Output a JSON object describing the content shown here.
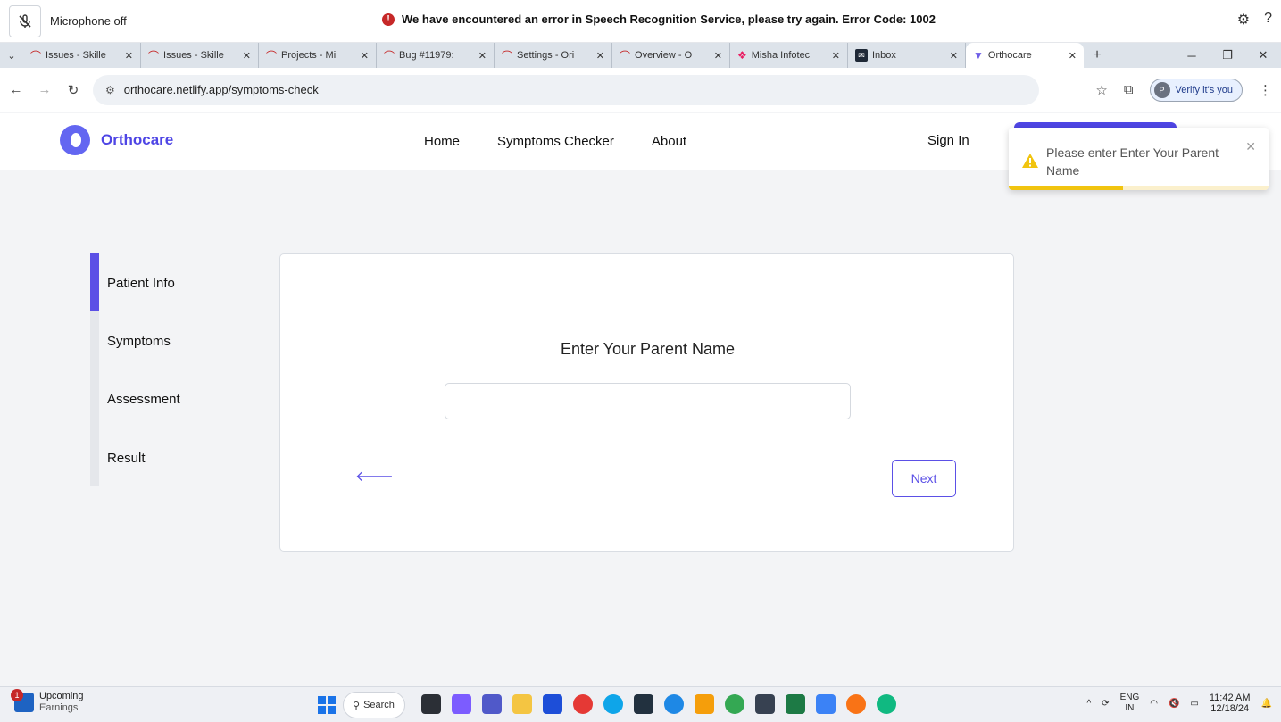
{
  "notification_bar": {
    "mic_status": "Microphone off",
    "error_message": "We have encountered an error in Speech Recognition Service, please try again. Error Code: 1002"
  },
  "tabs": [
    {
      "title": "Issues - Skille",
      "icon": "issue-icon",
      "active": false
    },
    {
      "title": "Issues - Skille",
      "icon": "issue-icon",
      "active": false
    },
    {
      "title": "Projects - Mi",
      "icon": "issue-icon",
      "active": false
    },
    {
      "title": "Bug #11979:",
      "icon": "issue-icon",
      "active": false
    },
    {
      "title": "Settings - Ori",
      "icon": "issue-icon",
      "active": false
    },
    {
      "title": "Overview - O",
      "icon": "issue-icon",
      "active": false
    },
    {
      "title": "Misha Infotec",
      "icon": "misha-icon",
      "active": false
    },
    {
      "title": "Inbox",
      "icon": "inbox-icon",
      "active": false
    },
    {
      "title": "Orthocare",
      "icon": "orthocare-icon",
      "active": true
    }
  ],
  "address_bar": {
    "url": "orthocare.netlify.app/symptoms-check",
    "verify_label": "Verify it's you",
    "verify_avatar": "P"
  },
  "app": {
    "brand": "Orthocare",
    "nav": [
      "Home",
      "Symptoms Checker",
      "About"
    ],
    "sign_in": "Sign In",
    "accent_color": "#4f46e5"
  },
  "toast": {
    "message": "Please enter Enter Your Parent Name",
    "progress": 0.44,
    "color": "#f1c40f"
  },
  "stepper": {
    "steps": [
      "Patient Info",
      "Symptoms",
      "Assessment",
      "Result"
    ],
    "active_index": 0
  },
  "form": {
    "question": "Enter Your Parent Name",
    "input_value": "",
    "next_label": "Next"
  },
  "taskbar": {
    "widget_title": "Upcoming",
    "widget_subtitle": "Earnings",
    "widget_badge": "1",
    "search_label": "Search",
    "lang_top": "ENG",
    "lang_bottom": "IN",
    "time": "11:42 AM",
    "date": "12/18/24"
  }
}
